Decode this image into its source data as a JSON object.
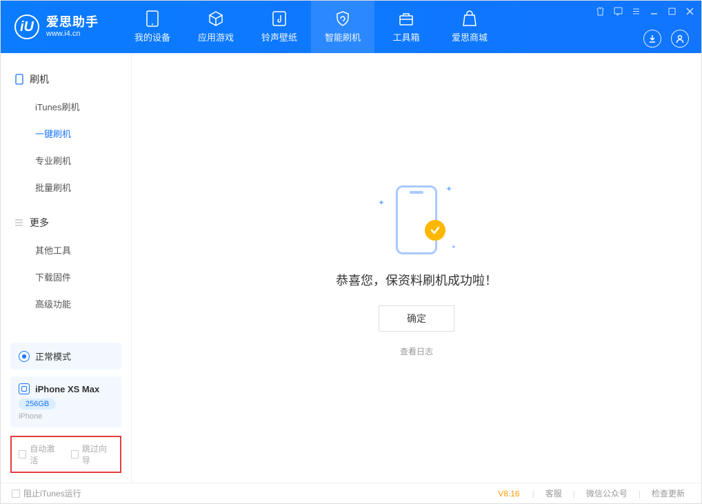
{
  "app": {
    "title": "爱思助手",
    "subtitle": "www.i4.cn"
  },
  "nav": {
    "tabs": [
      {
        "label": "我的设备"
      },
      {
        "label": "应用游戏"
      },
      {
        "label": "铃声壁纸"
      },
      {
        "label": "智能刷机"
      },
      {
        "label": "工具箱"
      },
      {
        "label": "爱思商城"
      }
    ]
  },
  "sidebar": {
    "section1": {
      "title": "刷机",
      "items": [
        {
          "label": "iTunes刷机"
        },
        {
          "label": "一键刷机"
        },
        {
          "label": "专业刷机"
        },
        {
          "label": "批量刷机"
        }
      ]
    },
    "section2": {
      "title": "更多",
      "items": [
        {
          "label": "其他工具"
        },
        {
          "label": "下载固件"
        },
        {
          "label": "高级功能"
        }
      ]
    },
    "mode_label": "正常模式",
    "device": {
      "name": "iPhone XS Max",
      "capacity": "256GB",
      "type": "iPhone"
    },
    "checks": {
      "auto_activate": "自动激活",
      "skip_guide": "跳过向导"
    }
  },
  "main": {
    "success_text": "恭喜您，保资料刷机成功啦！",
    "confirm_label": "确定",
    "view_log_label": "查看日志"
  },
  "footer": {
    "block_itunes": "阻止iTunes运行",
    "version": "V8.16",
    "links": {
      "service": "客服",
      "wechat": "微信公众号",
      "update": "检查更新"
    }
  }
}
